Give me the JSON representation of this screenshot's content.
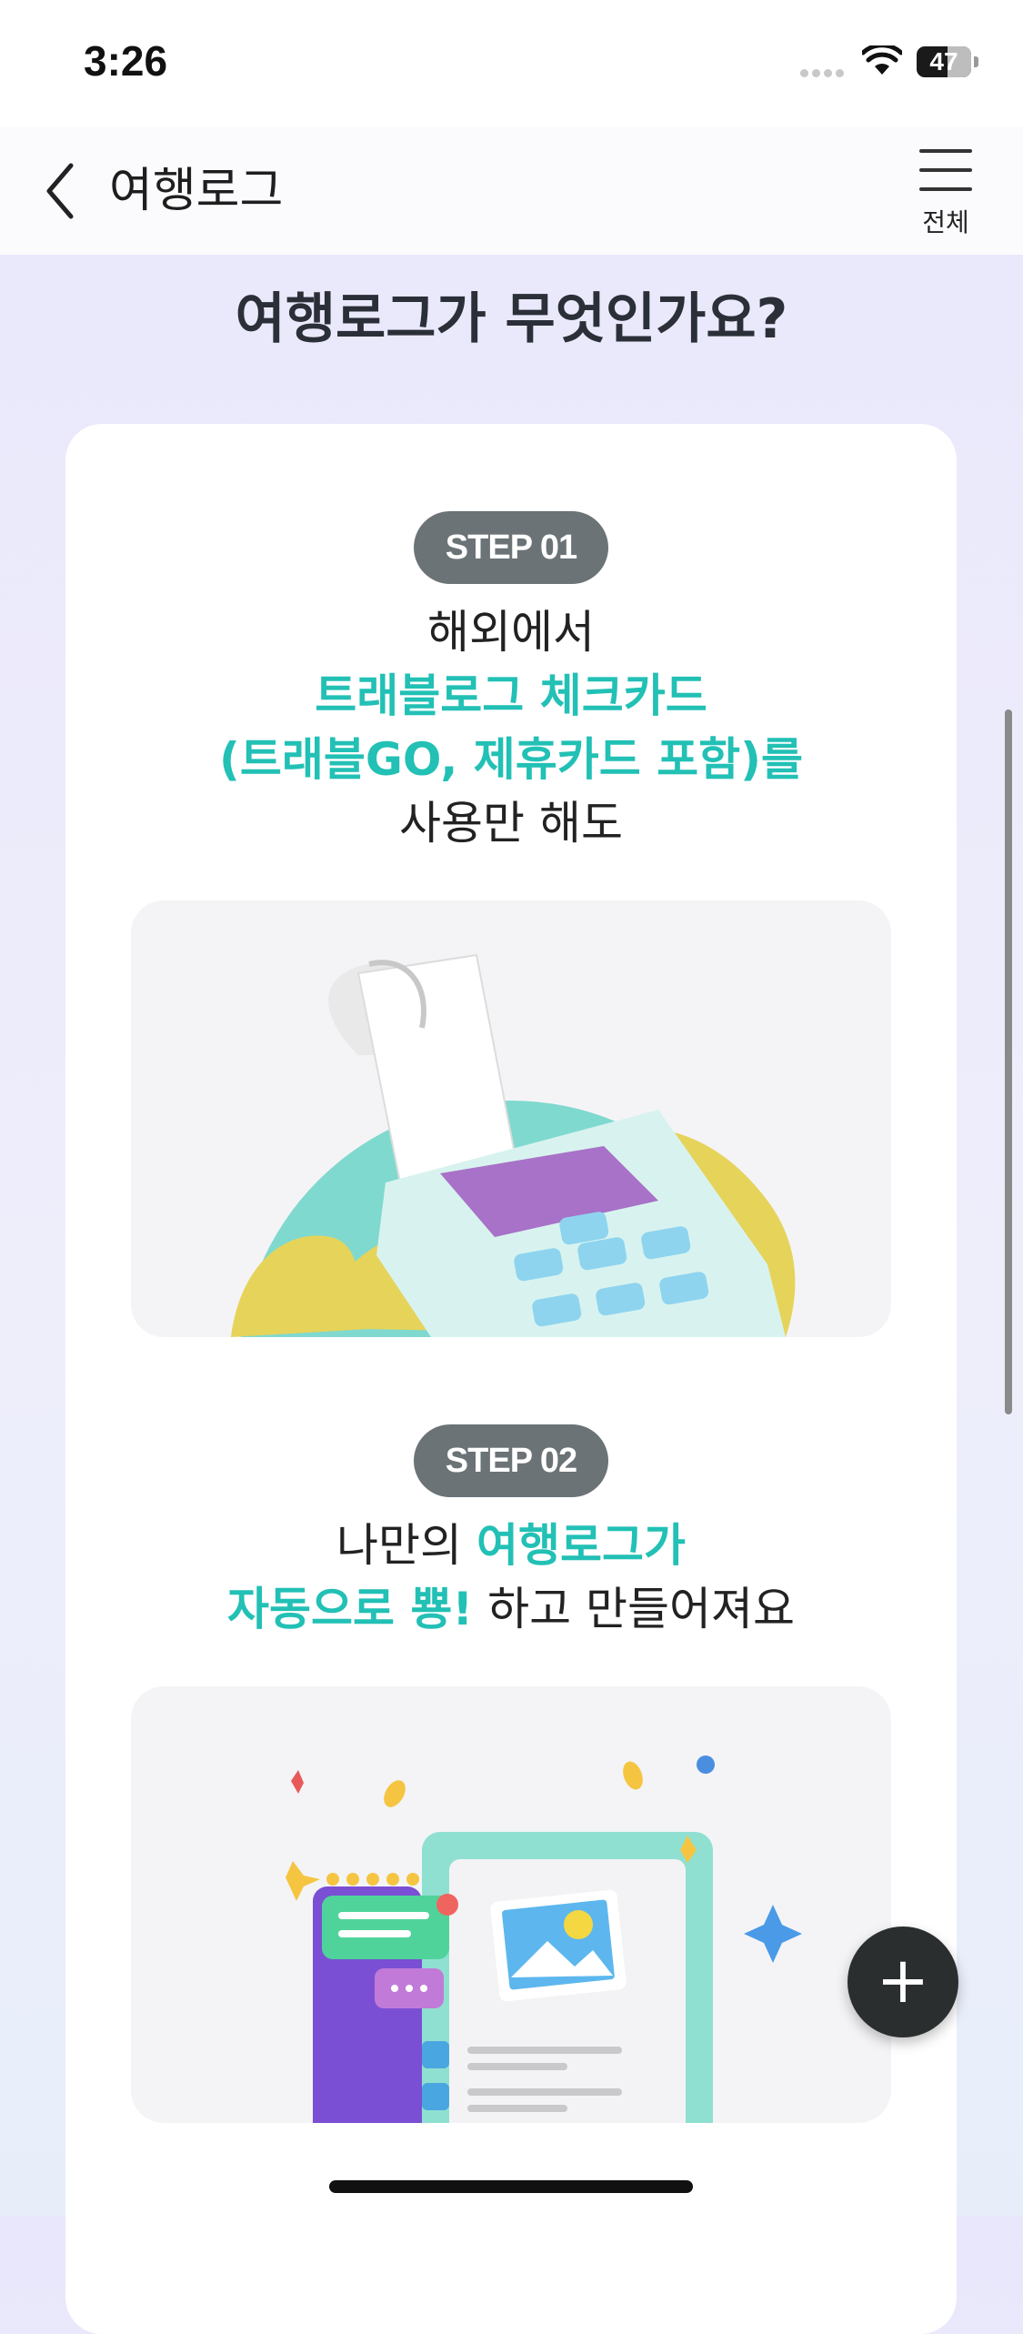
{
  "status_bar": {
    "time": "3:26",
    "battery": "47"
  },
  "nav": {
    "title": "여행로그",
    "menu_label": "전체"
  },
  "heading": "여행로그가 무엇인가요?",
  "steps": [
    {
      "badge": "STEP 01",
      "line1": "해외에서",
      "line2": "트래블로그 체크카드",
      "line3": "(트래블GO, 제휴카드 포함)를",
      "line4": "사용만 해도"
    },
    {
      "badge": "STEP 02",
      "line1_plain": "나만의 ",
      "line1_highlight": "여행로그가",
      "line2_highlight": "자동으로 뿅!",
      "line2_plain": " 하고 만들어져요"
    }
  ],
  "fab": {
    "label": "+"
  },
  "colors": {
    "accent": "#22c0b5",
    "badge": "#6b7377",
    "fab": "#2b2e2f",
    "background": "#e9e7fb"
  },
  "icons": [
    "back-chevron-icon",
    "hamburger-menu-icon",
    "wifi-icon",
    "battery-icon",
    "plus-icon"
  ]
}
